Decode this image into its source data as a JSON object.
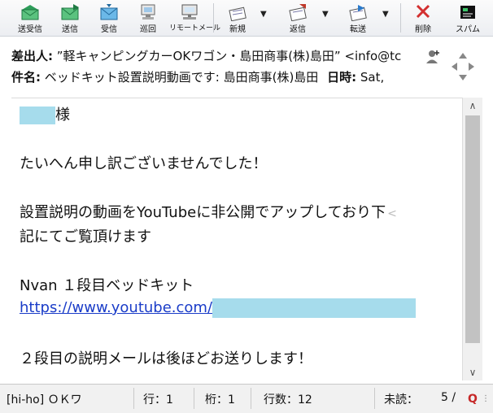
{
  "toolbar": {
    "send_receive": "送受信",
    "send": "送信",
    "receive": "受信",
    "patrol": "巡回",
    "remote_mail": "リモートメール",
    "new": "新規",
    "reply": "返信",
    "forward": "転送",
    "delete": "削除",
    "spam": "スパム"
  },
  "header": {
    "from_label": "差出人:",
    "from_value": "”軽キャンピングカーOKワゴン・島田商事(株)島田” <info@tc",
    "subject_label": "件名:",
    "subject_value": "ベッドキット設置説明動画です: 島田商事(株)島田",
    "date_label": "日時:",
    "date_value": "Sat,"
  },
  "body": {
    "salutation": "様",
    "line1": "たいへん申し訳ございませんでした！",
    "line2": "設置説明の動画をYouTubeに非公開でアップしており下",
    "line2_mark": "<",
    "line3": "記にてご覧頂けます",
    "line4": "Nvan １段目ベッドキット",
    "link": "https://www.youtube.com/",
    "line5": "２段目の説明メールは後ほどお送りします！"
  },
  "status": {
    "account": "[hi-ho] ＯＫワ",
    "row": "行：1",
    "col": "桁：1",
    "lines": "行数：12",
    "unread": "未読：",
    "count": "5 /"
  },
  "colors": {
    "mask": "#a6dcec",
    "link": "#1a3cc8",
    "delete_red": "#d32f2f",
    "q_red": "#c62828"
  }
}
